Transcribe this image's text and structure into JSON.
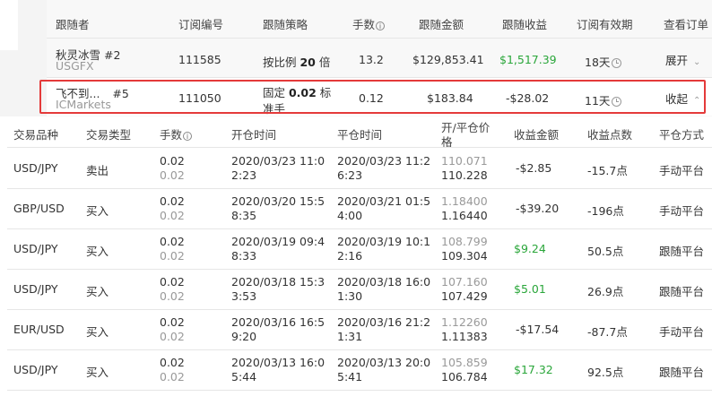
{
  "header": {
    "follower": "跟随者",
    "sub_id": "订阅编号",
    "strategy": "跟随策略",
    "lots": "手数",
    "amount": "跟随金额",
    "profit": "跟随收益",
    "validity": "订阅有效期",
    "view": "查看订单"
  },
  "subscriptions": [
    {
      "name": "秋灵冰雪 #2",
      "broker": "USGFX",
      "id": "111585",
      "strategy_prefix": "按比例 ",
      "strategy_value": "20",
      "strategy_suffix": " 倍",
      "strategy_line2": "",
      "lots": "13.2",
      "amount": "$129,853.41",
      "profit": "$1,517.39",
      "validity": "18天",
      "action": "展开"
    },
    {
      "name": "飞不到...",
      "name_suffix": "#5",
      "broker": "ICMarkets",
      "id": "111050",
      "strategy_prefix": "固定 ",
      "strategy_value": "0.02",
      "strategy_suffix": " 标",
      "strategy_line2": "准手",
      "lots": "0.12",
      "amount": "$183.84",
      "profit": "-$28.02",
      "validity": "11天",
      "action": "收起"
    }
  ],
  "orders_header": {
    "symbol": "交易品种",
    "type": "交易类型",
    "lots": "手数",
    "open_time": "开仓时间",
    "close_time": "平仓时间",
    "price": "开/平仓价",
    "price2": "格",
    "profit": "收益金额",
    "points": "收益点数",
    "close_method": "平仓方式"
  },
  "orders": [
    {
      "symbol": "USD/JPY",
      "type": "卖出",
      "lots1": "0.02",
      "lots2": "0.02",
      "open1": "2020/03/23 11:0",
      "open2": "2:23",
      "close1": "2020/03/23 11:2",
      "close2": "6:23",
      "price_open": "110.071",
      "price_close": "110.228",
      "profit": "-$2.85",
      "points": "-15.7点",
      "method": "手动平台"
    },
    {
      "symbol": "GBP/USD",
      "type": "买入",
      "lots1": "0.02",
      "lots2": "0.02",
      "open1": "2020/03/20 15:5",
      "open2": "8:35",
      "close1": "2020/03/21 01:5",
      "close2": "4:00",
      "price_open": "1.18400",
      "price_close": "1.16440",
      "profit": "-$39.20",
      "points": "-196点",
      "method": "手动平台"
    },
    {
      "symbol": "USD/JPY",
      "type": "买入",
      "lots1": "0.02",
      "lots2": "0.02",
      "open1": "2020/03/19 09:4",
      "open2": "8:33",
      "close1": "2020/03/19 10:1",
      "close2": "2:16",
      "price_open": "108.799",
      "price_close": "109.304",
      "profit": "$9.24",
      "points": "50.5点",
      "method": "跟随平台"
    },
    {
      "symbol": "USD/JPY",
      "type": "买入",
      "lots1": "0.02",
      "lots2": "0.02",
      "open1": "2020/03/18 15:3",
      "open2": "3:53",
      "close1": "2020/03/18 16:0",
      "close2": "1:30",
      "price_open": "107.160",
      "price_close": "107.429",
      "profit": "$5.01",
      "points": "26.9点",
      "method": "跟随平台"
    },
    {
      "symbol": "EUR/USD",
      "type": "买入",
      "lots1": "0.02",
      "lots2": "0.02",
      "open1": "2020/03/16 16:5",
      "open2": "9:20",
      "close1": "2020/03/16 21:2",
      "close2": "1:31",
      "price_open": "1.12260",
      "price_close": "1.11383",
      "profit": "-$17.54",
      "points": "-87.7点",
      "method": "手动平台"
    },
    {
      "symbol": "USD/JPY",
      "type": "买入",
      "lots1": "0.02",
      "lots2": "0.02",
      "open1": "2020/03/13 16:0",
      "open2": "5:44",
      "close1": "2020/03/13 20:0",
      "close2": "5:41",
      "price_open": "105.859",
      "price_close": "106.784",
      "profit": "$17.32",
      "points": "92.5点",
      "method": "跟随平台"
    }
  ],
  "colors": {
    "profit_positive": "#2aa63a",
    "highlight_border": "#e43a3a",
    "muted": "#999999"
  }
}
